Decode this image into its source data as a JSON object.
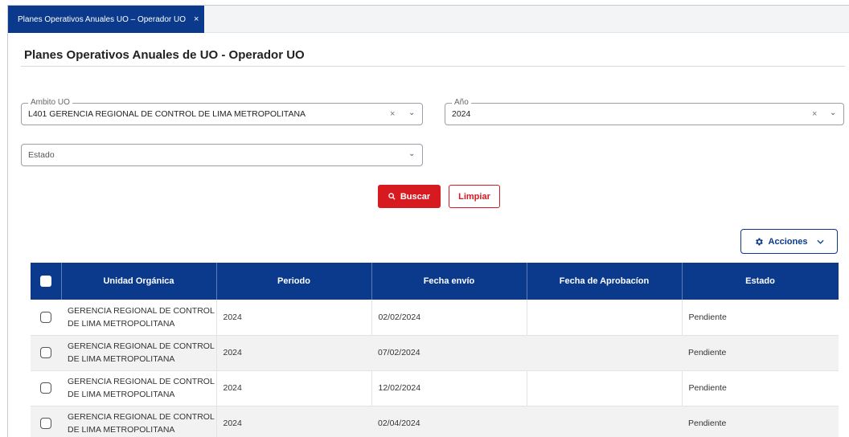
{
  "tab": {
    "label": "Planes Operativos Anuales UO – Operador UO",
    "close": "×"
  },
  "page": {
    "title": "Planes Operativos Anuales de UO - Operador UO"
  },
  "filters": {
    "ambito": {
      "label": "Ambito UO",
      "value": "L401 GERENCIA REGIONAL DE CONTROL DE LIMA METROPOLITANA",
      "clear": "×",
      "caret": "⌄"
    },
    "anio": {
      "label": "Año",
      "value": "2024",
      "clear": "×",
      "caret": "⌄"
    },
    "estado": {
      "placeholder": "Estado",
      "caret": "⌄"
    }
  },
  "buttons": {
    "buscar": "Buscar",
    "limpiar": "Limpiar",
    "acciones": "Acciones"
  },
  "icons": {
    "search": "search-icon",
    "gear": "gear-icon",
    "chevron": "chevron-down-icon"
  },
  "colors": {
    "primary": "#0b3a8c",
    "danger": "#d71920"
  },
  "table": {
    "headers": [
      "Unidad Orgánica",
      "Periodo",
      "Fecha envío",
      "Fecha de Aprobacíon",
      "Estado"
    ],
    "rows": [
      {
        "unidad_line1": "GERENCIA REGIONAL DE CONTROL",
        "unidad_line2": "DE LIMA METROPOLITANA",
        "periodo": "2024",
        "fecha_envio": "02/02/2024",
        "fecha_aprobacion": "",
        "estado": "Pendiente"
      },
      {
        "unidad_line1": "GERENCIA REGIONAL DE CONTROL",
        "unidad_line2": "DE LIMA METROPOLITANA",
        "periodo": "2024",
        "fecha_envio": "07/02/2024",
        "fecha_aprobacion": "",
        "estado": "Pendiente"
      },
      {
        "unidad_line1": "GERENCIA REGIONAL DE CONTROL",
        "unidad_line2": "DE LIMA METROPOLITANA",
        "periodo": "2024",
        "fecha_envio": "12/02/2024",
        "fecha_aprobacion": "",
        "estado": "Pendiente"
      },
      {
        "unidad_line1": "GERENCIA REGIONAL DE CONTROL",
        "unidad_line2": "DE LIMA METROPOLITANA",
        "periodo": "2024",
        "fecha_envio": "02/04/2024",
        "fecha_aprobacion": "",
        "estado": "Pendiente"
      }
    ]
  }
}
